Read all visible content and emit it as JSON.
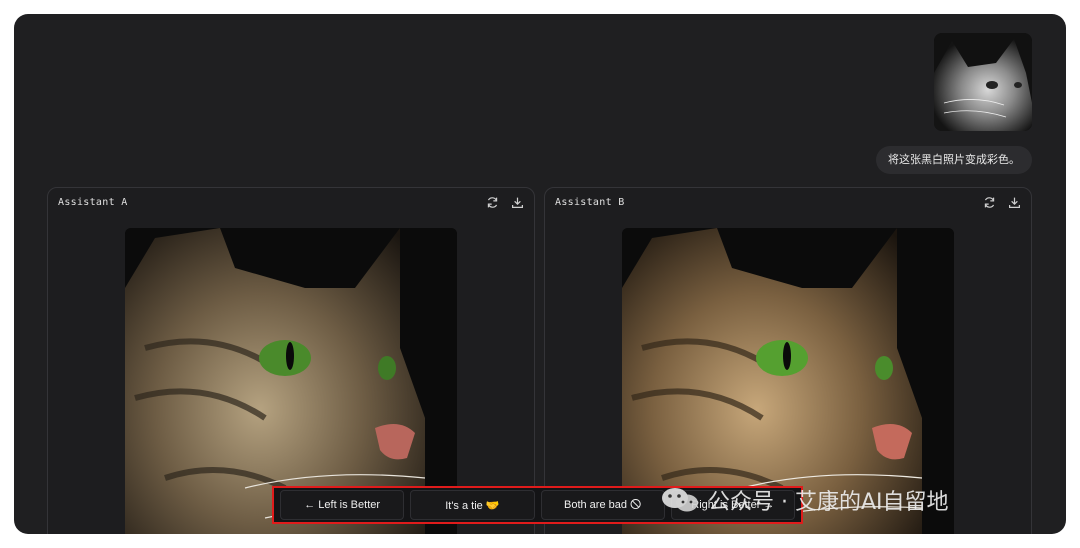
{
  "user_message": {
    "text": "将这张黑白照片变成彩色。"
  },
  "panels": [
    {
      "title": "Assistant A"
    },
    {
      "title": "Assistant B"
    }
  ],
  "vote": {
    "left": "← Left is Better",
    "tie": "It's a tie 🤝",
    "bad": "Both are bad 🛇",
    "right": "Right is Better →"
  },
  "watermark": {
    "text": "公众号 · 艾康的AI自留地"
  },
  "colors": {
    "background": "#1f1f21",
    "highlight": "#e01b1b",
    "cat_eye": "#6fbf3a"
  }
}
